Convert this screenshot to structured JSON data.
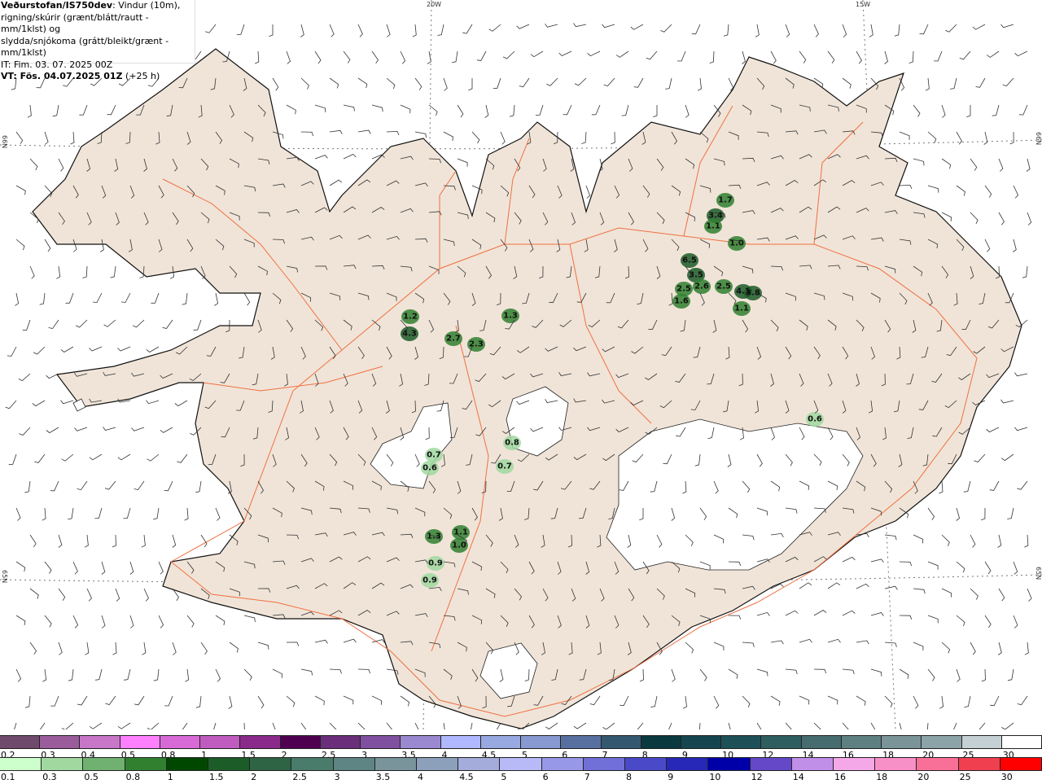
{
  "header": {
    "source": "Veðurstofan/IS750dev",
    "description_1": ": Vindur (10m),",
    "description_2": "rigning/skúrir (grænt/blátt/rautt - mm/1klst) og",
    "description_3": "slydda/snjókoma (grátt/bleikt/grænt - mm/1klst)",
    "initial_time": "IT: Fim. 03. 07. 2025 00Z",
    "valid_time": "VT: Fös. 04.07.2025 01Z",
    "lead_time": "(+25 h)"
  },
  "map": {
    "land_color": "#f0e4d8",
    "glacier_color": "#ffffff",
    "road_color": "#f07040",
    "grid_labels": {
      "lon_20w": "20W",
      "lon_15w": "15W",
      "lat_66n_left": "66N",
      "lat_66n_right": "66N",
      "lat_65n_left": "65N",
      "lat_65n_right": "65N"
    },
    "precip_labels": [
      "1.7",
      "3.4",
      "1.1",
      "1.0",
      "6.5",
      "3.5",
      "2.5",
      "2.6",
      "2.5",
      "4.1",
      "3.8",
      "1.6",
      "1.1",
      "1.2",
      "4.3",
      "2.7",
      "2.3",
      "1.3",
      "0.6",
      "0.8",
      "0.7",
      "0.7",
      "0.6",
      "1.1",
      "1.3",
      "1.0",
      "0.9",
      "0.9"
    ]
  },
  "legend": {
    "snow": {
      "labels": [
        "0.2",
        "0.3",
        "0.4",
        "0.5",
        "0.8",
        "1",
        "1.5",
        "2",
        "2.5",
        "3",
        "3.5",
        "4",
        "4.5",
        "5",
        "6",
        "7",
        "8",
        "9",
        "10",
        "12",
        "14",
        "16",
        "18",
        "20",
        "25",
        "30"
      ],
      "colors": [
        "#6f4a6c",
        "#9b5c9b",
        "#c876c8",
        "#ff80ff",
        "#d86ad8",
        "#c05cc0",
        "#8a2a8a",
        "#500050",
        "#6a2e7a",
        "#8050a0",
        "#9a88d0",
        "#b0b8ff",
        "#98a8e0",
        "#8898d0",
        "#5870a0",
        "#345870",
        "#0a3a40",
        "#154650",
        "#1e5058",
        "#2e5e60",
        "#466c70",
        "#5e8080",
        "#7a9498",
        "#8ca4a8",
        "#c4d0d4",
        "#ffffff"
      ]
    },
    "rain": {
      "labels": [
        "0.1",
        "0.3",
        "0.5",
        "0.8",
        "1",
        "1.5",
        "2",
        "2.5",
        "3",
        "3.5",
        "4",
        "4.5",
        "5",
        "6",
        "7",
        "8",
        "9",
        "10",
        "12",
        "14",
        "16",
        "18",
        "20",
        "25",
        "30"
      ],
      "colors": [
        "#ccffcc",
        "#a0d8a0",
        "#70b070",
        "#308030",
        "#004800",
        "#1c5c28",
        "#2e6444",
        "#4a7c6c",
        "#5e8484",
        "#7a949c",
        "#8ca0bc",
        "#a4acdc",
        "#b8baf8",
        "#9898e8",
        "#7070d8",
        "#4a4ac8",
        "#2828b8",
        "#0000a8",
        "#6448c8",
        "#c090e8",
        "#f4a8e8",
        "#f890c8",
        "#f87098",
        "#f04050",
        "#ff0000"
      ]
    }
  }
}
